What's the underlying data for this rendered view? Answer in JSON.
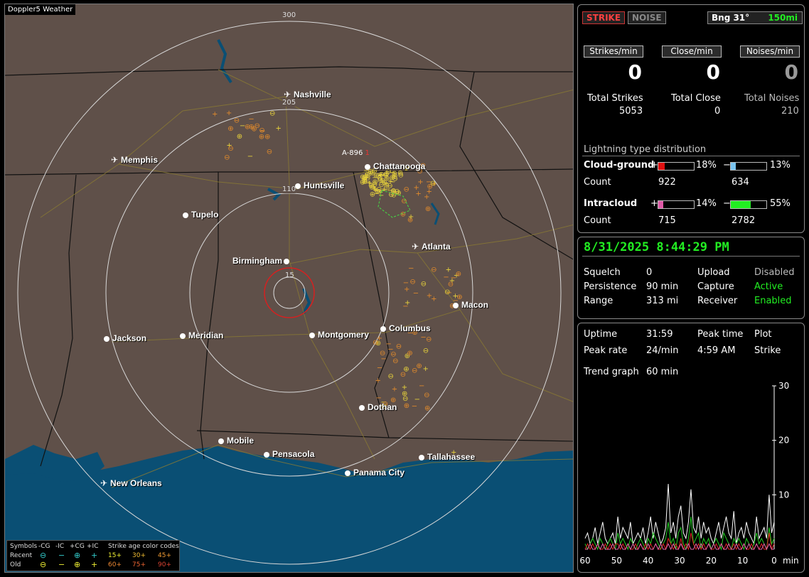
{
  "app": {
    "title": "Doppler5 Weather"
  },
  "map": {
    "range_labels": [
      "300",
      "205",
      "110",
      "15"
    ],
    "cities": [
      {
        "name": "Nashville",
        "type": "airport"
      },
      {
        "name": "Memphis",
        "type": "airport"
      },
      {
        "name": "Chattanooga",
        "type": "city"
      },
      {
        "name": "Huntsville",
        "type": "city"
      },
      {
        "name": "Tupelo",
        "type": "city"
      },
      {
        "name": "Atlanta",
        "type": "airport"
      },
      {
        "name": "Birmingham",
        "type": "city"
      },
      {
        "name": "Macon",
        "type": "city"
      },
      {
        "name": "Jackson",
        "type": "city"
      },
      {
        "name": "Meridian",
        "type": "city"
      },
      {
        "name": "Montgomery",
        "type": "city"
      },
      {
        "name": "Columbus",
        "type": "city"
      },
      {
        "name": "Dothan",
        "type": "city"
      },
      {
        "name": "Mobile",
        "type": "city"
      },
      {
        "name": "Pensacola",
        "type": "city"
      },
      {
        "name": "Tallahassee",
        "type": "city"
      },
      {
        "name": "Panama City",
        "type": "city"
      },
      {
        "name": "New Orleans",
        "type": "airport"
      }
    ],
    "storm_cell_label": "A-896",
    "storm_cell_suffix": "1",
    "colors": {
      "land": "#5f5049",
      "water": "#0a4f74",
      "roads": "#8a7a33",
      "rings": "#d8d8d8",
      "recent": "#e7d23b",
      "old": "#e08a2c"
    }
  },
  "legend": {
    "symbols_label": "Symbols",
    "headers": [
      "-CG",
      "-IC",
      "+CG",
      "+IC"
    ],
    "recent_label": "Recent",
    "old_label": "Old",
    "age_title": "Strike age color codes",
    "recent_ages": [
      "15+",
      "30+",
      "45+"
    ],
    "old_ages": [
      "60+",
      "75+",
      "90+"
    ]
  },
  "top": {
    "strike_btn": "STRIKE",
    "noise_btn": "NOISE",
    "bearing": "Bng 31°",
    "distance": "150mi",
    "strikes_min_label": "Strikes/min",
    "close_min_label": "Close/min",
    "noises_min_label": "Noises/min",
    "strikes_min": "0",
    "close_min": "0",
    "noises_min": "0",
    "total_strikes_label": "Total Strikes",
    "total_close_label": "Total Close",
    "total_noises_label": "Total Noises",
    "total_strikes": "5053",
    "total_close": "0",
    "total_noises": "210",
    "dist_title": "Lightning type distribution",
    "cg_label": "Cloud-ground",
    "ic_label": "Intracloud",
    "count_label": "Count",
    "plus": "+",
    "minus": "−",
    "cg_pos_pct": "18%",
    "cg_neg_pct": "13%",
    "cg_pos_count": "922",
    "cg_neg_count": "634",
    "ic_pos_pct": "14%",
    "ic_neg_pct": "55%",
    "ic_pos_count": "715",
    "ic_neg_count": "2782",
    "cg_pos_frac": 0.18,
    "cg_neg_frac": 0.13,
    "ic_pos_frac": 0.14,
    "ic_neg_frac": 0.55
  },
  "status": {
    "datetime": "8/31/2025 8:44:29 PM",
    "squelch_label": "Squelch",
    "squelch": "0",
    "persistence_label": "Persistence",
    "persistence": "90 min",
    "range_label": "Range",
    "range": "313 mi",
    "upload_label": "Upload",
    "upload": "Disabled",
    "capture_label": "Capture",
    "capture": "Active",
    "receiver_label": "Receiver",
    "receiver": "Enabled"
  },
  "stats": {
    "uptime_label": "Uptime",
    "uptime": "31:59",
    "peak_time_label": "Peak time",
    "plot_label": "Plot",
    "peak_rate_label": "Peak rate",
    "peak_rate": "24/min",
    "peak_time": "4:59 AM",
    "plot": "Strike",
    "trend_label": "Trend graph",
    "trend": "60 min"
  },
  "chart_data": {
    "type": "line",
    "x_ticks": [
      "60",
      "50",
      "40",
      "30",
      "20",
      "10",
      "0"
    ],
    "x_unit": "min",
    "y_ticks": [
      "30",
      "20",
      "10"
    ],
    "ylim": [
      0,
      30
    ],
    "series": [
      {
        "color": "#ffffff",
        "values": [
          2,
          3,
          1,
          2,
          4,
          1,
          3,
          5,
          2,
          1,
          2,
          3,
          1,
          6,
          2,
          4,
          3,
          2,
          5,
          1,
          2,
          3,
          2,
          4,
          1,
          3,
          6,
          2,
          5,
          3,
          1,
          2,
          4,
          12,
          3,
          5,
          2,
          6,
          8,
          3,
          2,
          5,
          11,
          4,
          3,
          6,
          2,
          5,
          3,
          4,
          2,
          1,
          3,
          5,
          2,
          4,
          6,
          3,
          2,
          7,
          1,
          3,
          4,
          2,
          5,
          3,
          2,
          1,
          6,
          2,
          3,
          4,
          2,
          10,
          3,
          5
        ]
      },
      {
        "color": "#22cc22",
        "values": [
          1,
          0,
          1,
          2,
          1,
          0,
          2,
          1,
          0,
          1,
          2,
          1,
          0,
          3,
          1,
          2,
          1,
          0,
          2,
          1,
          0,
          1,
          2,
          1,
          0,
          2,
          1,
          3,
          2,
          1,
          0,
          1,
          2,
          5,
          1,
          2,
          0,
          3,
          4,
          1,
          0,
          2,
          6,
          1,
          2,
          3,
          0,
          2,
          1,
          2,
          0,
          1,
          2,
          1,
          0,
          3,
          2,
          1,
          0,
          2,
          1,
          2,
          1,
          0,
          2,
          1,
          0,
          1,
          3,
          1,
          2,
          1,
          0,
          4,
          1,
          2
        ]
      },
      {
        "color": "#dd2222",
        "values": [
          0,
          1,
          0,
          1,
          0,
          1,
          0,
          0,
          1,
          0,
          1,
          0,
          1,
          1,
          0,
          1,
          0,
          1,
          0,
          0,
          1,
          0,
          1,
          0,
          1,
          0,
          1,
          0,
          1,
          0,
          0,
          1,
          0,
          2,
          1,
          0,
          1,
          0,
          2,
          0,
          1,
          0,
          3,
          1,
          0,
          1,
          0,
          1,
          0,
          1,
          0,
          0,
          1,
          0,
          1,
          0,
          1,
          0,
          0,
          1,
          0,
          1,
          0,
          1,
          0,
          0,
          1,
          0,
          1,
          0,
          1,
          0,
          0,
          3,
          0,
          1
        ]
      },
      {
        "color": "#dd66aa",
        "values": [
          0,
          0,
          1,
          0,
          0,
          1,
          0,
          1,
          0,
          0,
          0,
          1,
          0,
          0,
          1,
          0,
          0,
          1,
          0,
          1,
          0,
          0,
          1,
          0,
          0,
          1,
          0,
          0,
          1,
          0,
          1,
          0,
          0,
          1,
          0,
          1,
          0,
          0,
          1,
          0,
          0,
          1,
          0,
          0,
          1,
          0,
          1,
          0,
          0,
          1,
          0,
          1,
          0,
          0,
          1,
          0,
          0,
          1,
          0,
          0,
          1,
          0,
          0,
          1,
          0,
          1,
          0,
          0,
          1,
          0,
          0,
          1,
          0,
          1,
          0,
          0
        ]
      }
    ]
  }
}
